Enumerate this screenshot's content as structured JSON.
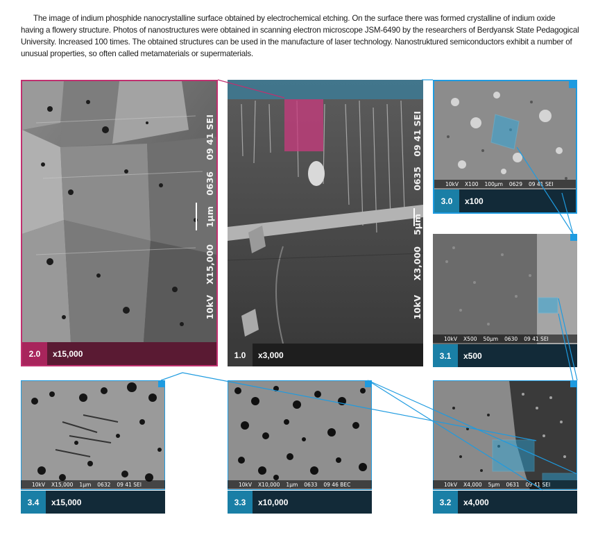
{
  "description": "The image of indium phosphide nanocrystalline surface obtained by electrochemical etching. On the surface there was formed crystalline of indium oxide having a flowery structure. Photos of nanostructures were obtained in scanning electron microscope JSM-6490 by the researchers of Berdyansk State Pedagogical University. Increased 100 times. The obtained structures can be used in the manufacture of laser technology. Nanostruktured semiconductors exhibit a number of unusual properties, so often called metamaterials or supermaterials.",
  "panels": {
    "p20": {
      "num": "2.0",
      "mag": "x15,000",
      "scale": "1μm",
      "label1": "09 41 SEI",
      "label2": "0636",
      "label3": "X15,000",
      "label4": "10kV"
    },
    "p10": {
      "num": "1.0",
      "mag": "x3,000",
      "scale": "5μm",
      "label1": "09 41 SEI",
      "label2": "0635",
      "label3": "X3,000",
      "label4": "10kV"
    },
    "p30": {
      "num": "3.0",
      "mag": "x100",
      "bar": [
        "10kV",
        "X100",
        "100μm",
        "0629",
        "09 41 SEI"
      ]
    },
    "p31": {
      "num": "3.1",
      "mag": "x500",
      "bar": [
        "10kV",
        "X500",
        "50μm",
        "0630",
        "09 41 SEI"
      ]
    },
    "p32": {
      "num": "3.2",
      "mag": "x4,000",
      "bar": [
        "10kV",
        "X4,000",
        "5μm",
        "0631",
        "09 41 SEI"
      ]
    },
    "p33": {
      "num": "3.3",
      "mag": "x10,000",
      "bar": [
        "10kV",
        "X10,000",
        "1μm",
        "0633",
        "09 46 BEC"
      ]
    },
    "p34": {
      "num": "3.4",
      "mag": "x15,000",
      "bar": [
        "10kV",
        "X15,000",
        "1μm",
        "0632",
        "09 41 SEI"
      ]
    }
  },
  "colors": {
    "accent_blue": "#1e9be0",
    "accent_pink": "#c0306f",
    "caption_dark": "#122a38"
  }
}
